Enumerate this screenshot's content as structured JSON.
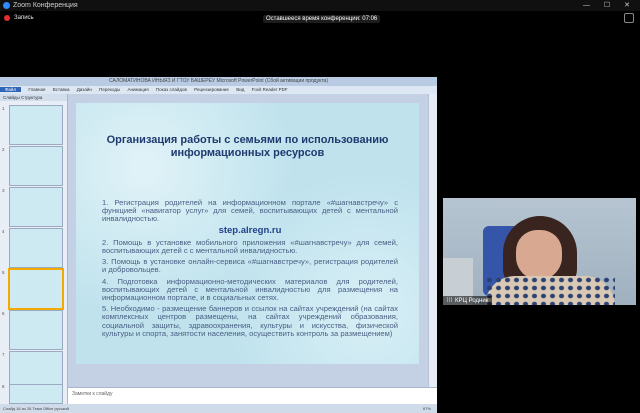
{
  "zoom": {
    "window_title": "Zoom Конференция",
    "window_controls": "— ☐ ✕",
    "recording_label": "Запись",
    "timer_text": "Оставшееся время конференции: 07:06"
  },
  "powerpoint": {
    "title": "САЛОМАТИНОВА ИНЫЯЗ И ГТОУ БАШЕРЕУ Microsoft PowerPoint (Сбой активации продукта)",
    "tabs": [
      "Файл",
      "Главная",
      "Вставка",
      "Дизайн",
      "Переходы",
      "Анимация",
      "Показ слайдов",
      "Рецензирование",
      "Вид",
      "Foxit Reader PDF"
    ],
    "sidebar_tabs": "Слайды   Структура",
    "slide_numbers": [
      "1",
      "2",
      "3",
      "4",
      "5",
      "6",
      "7",
      "8"
    ],
    "notes_placeholder": "Заметки к слайду",
    "status_left": "Слайд 16 из 26   Тема Office   русский",
    "status_right": "67%"
  },
  "slide": {
    "heading": "Организация работы с семьями по использованию информационных ресурсов",
    "items": [
      "1. Регистрация родителей на информационном портале «#шагнавстречу» с функцией «навигатор услуг» для семей, воспитывающих детей с ментальной инвалидностью.",
      "2. Помощь в установке мобильного приложения «#шагнавстречу» для семей, воспитывающих детей с с ментальной инвалидностью.",
      "3. Помощь в установке онлайн-сервиса «#шагнавстречу», регистрация родителей и добровольцев.",
      "4. Подготовка информационно-методических материалов для родителей, воспитывающих детей с ментальной инвалидностью для размещения на информационном портале, и в социальных сетях.",
      "5. Необходимо - размещение баннеров и ссылок на сайтах учреждений (на сайтах комплексных центров размещены, на сайтах учреждений образования, социальной защиты, здравоохранения, культуры и искусства, физической культуры и спорта, занятости населения, осуществить контроль за размещением)"
    ],
    "link": "step.alregn.ru"
  },
  "video": {
    "participant_name": "КРЦ Родник"
  }
}
